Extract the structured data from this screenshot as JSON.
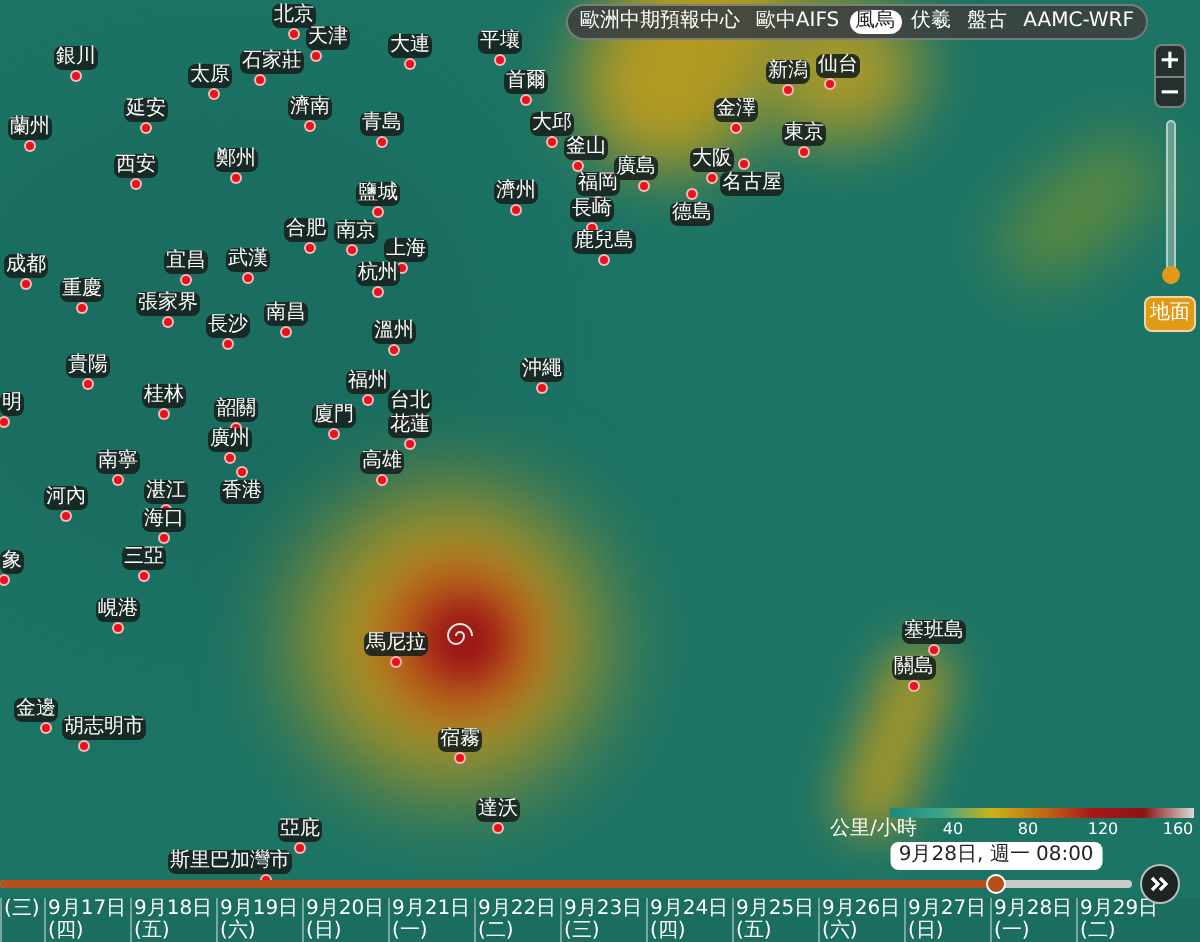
{
  "model_tabs": [
    {
      "label": "歐洲中期預報中心",
      "selected": false
    },
    {
      "label": "歐中AIFS",
      "selected": false
    },
    {
      "label": "風烏",
      "selected": true
    },
    {
      "label": "伏羲",
      "selected": false
    },
    {
      "label": "盤古",
      "selected": false
    },
    {
      "label": "AAMC-WRF",
      "selected": false
    }
  ],
  "zoom_controls": {
    "zoom_in": "+",
    "zoom_out": "−",
    "level": 0
  },
  "layer_button": "地面",
  "cities": [
    "北京",
    "天津",
    "銀川",
    "石家莊",
    "太原",
    "大連",
    "平壤",
    "首爾",
    "延安",
    "濟南",
    "蘭州",
    "青島",
    "大邱",
    "釜山",
    "西安",
    "鄭州",
    "鹽城",
    "濟州",
    "合肥",
    "南京",
    "上海",
    "成都",
    "宜昌",
    "武漢",
    "杭州",
    "重慶",
    "張家界",
    "南昌",
    "長沙",
    "溫州",
    "貴陽",
    "沖繩",
    "福州",
    "明",
    "桂林",
    "韶關",
    "台北",
    "廈門",
    "花蓮",
    "廣州",
    "南寧",
    "高雄",
    "河內",
    "湛江",
    "香港",
    "海口",
    "象",
    "三亞",
    "峴港",
    "馬尼拉",
    "金邊",
    "胡志明市",
    "宿霧",
    "達沃",
    "亞庇",
    "斯里巴加灣市",
    "新潟",
    "仙台",
    "金澤",
    "東京",
    "福岡",
    "廣島",
    "大阪",
    "名古屋",
    "德島",
    "長崎",
    "鹿兒島",
    "塞班島",
    "關島"
  ],
  "legend": {
    "caption": "公里/小時",
    "ticks": [
      "40",
      "80",
      "120",
      "160"
    ]
  },
  "timeline": {
    "level": 0.88,
    "tooltip": "9月28日, 週一 08:00",
    "dates": [
      "(三)",
      "9月17日 (四)",
      "9月18日 (五)",
      "9月19日 (六)",
      "9月20日 (日)",
      "9月21日 (一)",
      "9月22日 (二)",
      "9月23日 (三)",
      "9月24日 (四)",
      "9月25日 (五)",
      "9月26日 (六)",
      "9月27日 (日)",
      "9月28日 (一)",
      "9月29日 (二)"
    ]
  }
}
